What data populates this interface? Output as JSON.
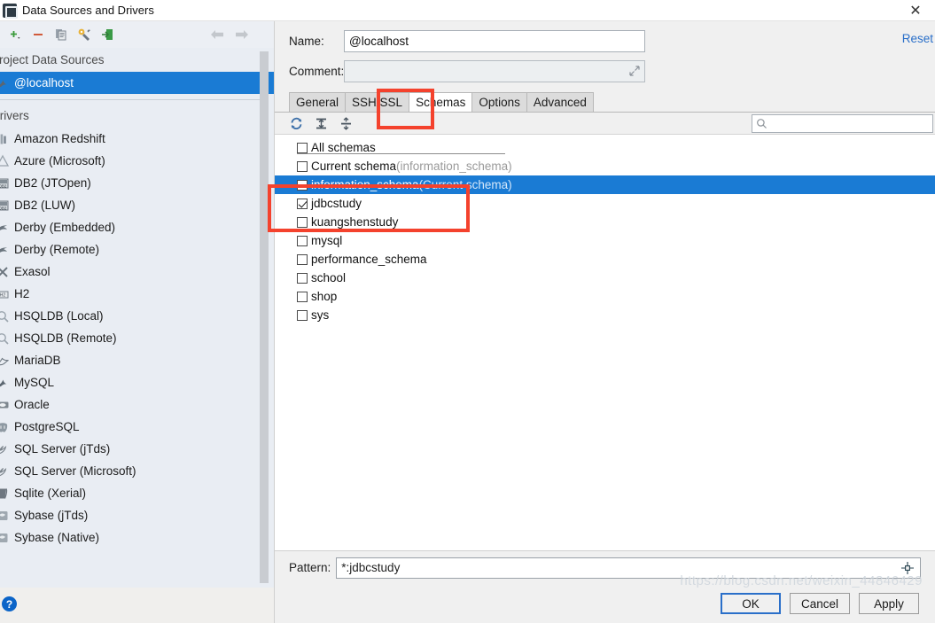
{
  "window": {
    "title": "Data Sources and Drivers",
    "close_icon": "close-icon"
  },
  "sidebar": {
    "toolbar": [
      {
        "name": "add-icon",
        "label": "+"
      },
      {
        "name": "remove-icon",
        "label": "−"
      },
      {
        "name": "copy-icon",
        "label": "copy"
      },
      {
        "name": "wrench-icon",
        "label": "wrench"
      },
      {
        "name": "import-icon",
        "label": "import"
      }
    ],
    "nav": [
      {
        "name": "back-arrow-icon",
        "label": "⇦"
      },
      {
        "name": "forward-arrow-icon",
        "label": "⇨"
      }
    ],
    "groups": [
      {
        "title": "Project Data Sources",
        "items": [
          {
            "label": "@localhost",
            "icon": "mysql-dolphin-icon",
            "selected": true
          }
        ]
      },
      {
        "title": "Drivers",
        "items": [
          {
            "label": "Amazon Redshift",
            "icon": "redshift-icon",
            "selected": false
          },
          {
            "label": "Azure (Microsoft)",
            "icon": "azure-icon",
            "selected": false
          },
          {
            "label": "DB2 (JTOpen)",
            "icon": "db2-icon",
            "selected": false
          },
          {
            "label": "DB2 (LUW)",
            "icon": "db2-icon",
            "selected": false
          },
          {
            "label": "Derby (Embedded)",
            "icon": "derby-icon",
            "selected": false
          },
          {
            "label": "Derby (Remote)",
            "icon": "derby-icon",
            "selected": false
          },
          {
            "label": "Exasol",
            "icon": "exasol-icon",
            "selected": false
          },
          {
            "label": "H2",
            "icon": "h2-icon",
            "selected": false
          },
          {
            "label": "HSQLDB (Local)",
            "icon": "hsqldb-icon",
            "selected": false
          },
          {
            "label": "HSQLDB (Remote)",
            "icon": "hsqldb-icon",
            "selected": false
          },
          {
            "label": "MariaDB",
            "icon": "mariadb-icon",
            "selected": false
          },
          {
            "label": "MySQL",
            "icon": "mysql-dolphin-icon",
            "selected": false
          },
          {
            "label": "Oracle",
            "icon": "oracle-icon",
            "selected": false
          },
          {
            "label": "PostgreSQL",
            "icon": "postgresql-icon",
            "selected": false
          },
          {
            "label": "SQL Server (jTds)",
            "icon": "sqlserver-icon",
            "selected": false
          },
          {
            "label": "SQL Server (Microsoft)",
            "icon": "sqlserver-icon",
            "selected": false
          },
          {
            "label": "Sqlite (Xerial)",
            "icon": "sqlite-icon",
            "selected": false
          },
          {
            "label": "Sybase (jTds)",
            "icon": "sybase-icon",
            "selected": false
          },
          {
            "label": "Sybase (Native)",
            "icon": "sybase-icon",
            "selected": false
          }
        ]
      }
    ],
    "help_icon_label": "?"
  },
  "form": {
    "name_label": "Name:",
    "name_value": "@localhost",
    "comment_label": "Comment:",
    "comment_value": "",
    "comment_placeholder": "",
    "reset_label": "Reset"
  },
  "tabs": [
    {
      "label": "General",
      "active": false
    },
    {
      "label": "SSH/SSL",
      "active": false
    },
    {
      "label": "Schemas",
      "active": true
    },
    {
      "label": "Options",
      "active": false
    },
    {
      "label": "Advanced",
      "active": false
    }
  ],
  "schemas": {
    "toolbar": [
      {
        "name": "refresh-icon"
      },
      {
        "name": "expand-all-icon"
      },
      {
        "name": "collapse-all-icon"
      }
    ],
    "search_placeholder": "",
    "search_value": "",
    "rows": [
      {
        "label": "All schemas",
        "note": "",
        "checked": false,
        "selected": false,
        "header": true
      },
      {
        "label": "Current schema",
        "note": "(information_schema)",
        "checked": false,
        "selected": false,
        "header": true
      },
      {
        "label": "information_schema",
        "note": "(Current schema)",
        "checked": false,
        "selected": true,
        "header": false
      },
      {
        "label": "jdbcstudy",
        "note": "",
        "checked": true,
        "selected": false,
        "header": false
      },
      {
        "label": "kuangshenstudy",
        "note": "",
        "checked": false,
        "selected": false,
        "header": false
      },
      {
        "label": "mysql",
        "note": "",
        "checked": false,
        "selected": false,
        "header": false
      },
      {
        "label": "performance_schema",
        "note": "",
        "checked": false,
        "selected": false,
        "header": false
      },
      {
        "label": "school",
        "note": "",
        "checked": false,
        "selected": false,
        "header": false
      },
      {
        "label": "shop",
        "note": "",
        "checked": false,
        "selected": false,
        "header": false
      },
      {
        "label": "sys",
        "note": "",
        "checked": false,
        "selected": false,
        "header": false
      }
    ]
  },
  "pattern": {
    "label": "Pattern:",
    "value": "*:jdbcstudy"
  },
  "buttons": {
    "ok": "OK",
    "cancel": "Cancel",
    "apply": "Apply"
  },
  "watermark": "https://blog.csdn.net/weixin_44846429",
  "colors": {
    "accent": "#1a7bd4",
    "annotation": "#f4422d",
    "link": "#2a6fc9"
  }
}
